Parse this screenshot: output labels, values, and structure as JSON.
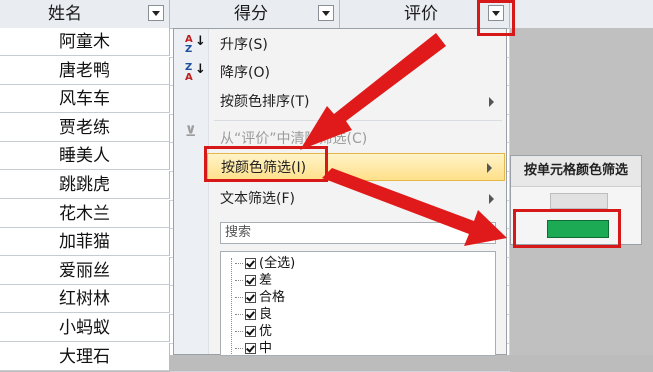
{
  "header": {
    "col_name": "姓名",
    "col_score": "得分",
    "col_eval": "评价"
  },
  "names": [
    "阿童木",
    "唐老鸭",
    "风车车",
    "贾老练",
    "睡美人",
    "跳跳虎",
    "花木兰",
    "加菲猫",
    "爱丽丝",
    "红树林",
    "小蚂蚁",
    "大理石"
  ],
  "menu": {
    "sort_asc": "升序(S)",
    "sort_desc": "降序(O)",
    "sort_by_color": "按颜色排序(T)",
    "clear_filter": "从“评价”中清除筛选(C)",
    "filter_by_color": "按颜色筛选(I)",
    "text_filter": "文本筛选(F)",
    "search_placeholder": "搜索",
    "checklist": [
      "(全选)",
      "差",
      "合格",
      "良",
      "优",
      "中"
    ],
    "icons": {
      "sort_asc_icon": "A→Z",
      "sort_desc_icon": "Z→A"
    }
  },
  "submenu": {
    "title": "按单元格颜色筛选",
    "swatch_color": "#1daa54"
  },
  "colors": {
    "highlight": "#ffe08a",
    "annotation_red": "#d61818"
  }
}
